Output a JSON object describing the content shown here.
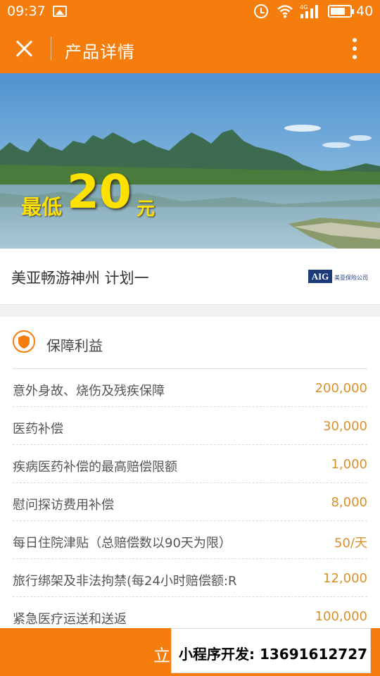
{
  "status_bar": {
    "time": "09:37",
    "battery": "40",
    "network_label": "4G"
  },
  "header": {
    "title": "产品详情",
    "close_icon": "close-icon",
    "more_icon": "more-vertical-icon"
  },
  "banner": {
    "prefix": "最低",
    "price": "20",
    "unit": "元"
  },
  "product": {
    "name": "美亚畅游神州 计划一",
    "insurer_mark": "AIG",
    "insurer_name": "美亚保险公司"
  },
  "benefits": {
    "title": "保障利益",
    "icon": "shield-icon",
    "items": [
      {
        "label": "意外身故、烧伤及残疾保障",
        "value": "200,000"
      },
      {
        "label": "医药补偿",
        "value": "30,000"
      },
      {
        "label": "疾病医药补偿的最高赔偿限额",
        "value": "1,000"
      },
      {
        "label": "慰问探访费用补偿",
        "value": "8,000"
      },
      {
        "label": "每日住院津贴（总赔偿数以90天为限）",
        "value": "50/天"
      },
      {
        "label": "旅行绑架及非法拘禁(每24小时赔偿额:R",
        "value": "12,000"
      },
      {
        "label": "紧急医疗运送和送返",
        "value": "100,000"
      }
    ]
  },
  "footer": {
    "buy_label": "立",
    "watermark": "小程序开发: 13691612727"
  },
  "colors": {
    "brand": "#f47d0e",
    "value": "#d9902a",
    "banner_text": "#ffe100"
  }
}
